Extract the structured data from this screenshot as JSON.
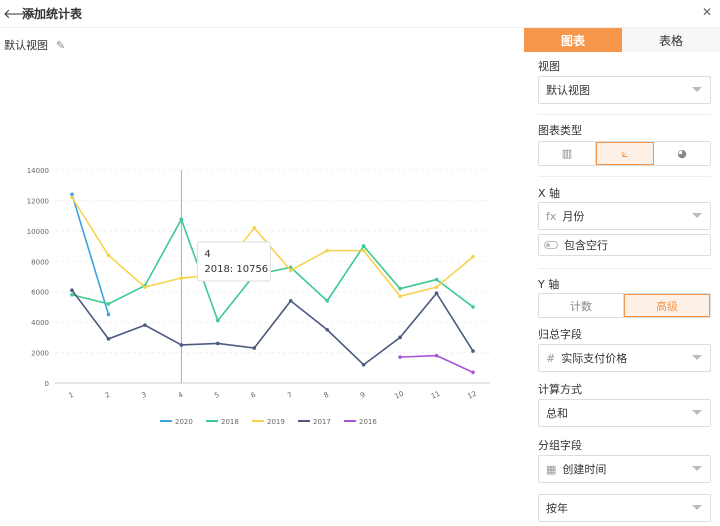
{
  "header": {
    "title": "添加统计表",
    "back_icon": "arrow-left-icon",
    "close_icon": "close-icon"
  },
  "view": {
    "name": "默认视图",
    "edit_icon": "pencil-icon"
  },
  "sidebar": {
    "tabs": [
      {
        "label": "图表",
        "active": true
      },
      {
        "label": "表格",
        "active": false
      }
    ],
    "view_label": "视图",
    "view_value": "默认视图",
    "chart_type_label": "图表类型",
    "chart_types": [
      {
        "icon": "bar-chart-icon",
        "glyph": "▥",
        "active": false
      },
      {
        "icon": "line-chart-icon",
        "glyph": "⟀",
        "active": true
      },
      {
        "icon": "pie-chart-icon",
        "glyph": "◕",
        "active": false
      }
    ],
    "x_axis_label": "X 轴",
    "x_axis_field": "月份",
    "x_axis_field_icon": "fx",
    "include_empty_label": "包含空行",
    "y_axis_label": "Y 轴",
    "y_axis_modes": [
      {
        "label": "计数",
        "active": false
      },
      {
        "label": "高级",
        "active": true
      }
    ],
    "agg_field_label": "归总字段",
    "agg_field_value": "实际支付价格",
    "agg_field_icon": "#",
    "calc_label": "计算方式",
    "calc_value": "总和",
    "group_label": "分组字段",
    "group_value": "创建时间",
    "group_icon": "▦",
    "group_granularity": "按年"
  },
  "colors": {
    "accent": "#f6964a"
  },
  "chart_data": {
    "type": "line",
    "categories": [
      "1",
      "2",
      "3",
      "4",
      "5",
      "6",
      "7",
      "8",
      "9",
      "10",
      "11",
      "12"
    ],
    "ylim": [
      0,
      14000
    ],
    "yticks": [
      0,
      2000,
      4000,
      6000,
      8000,
      10000,
      12000,
      14000
    ],
    "grid": true,
    "legend_position": "bottom",
    "series": [
      {
        "name": "2020",
        "color": "#3ba3e0",
        "values": [
          12400,
          4500,
          null,
          null,
          null,
          null,
          null,
          null,
          null,
          null,
          null,
          null
        ]
      },
      {
        "name": "2018",
        "color": "#3dca90",
        "values": [
          5800,
          5200,
          6400,
          10756,
          4100,
          7100,
          7600,
          5400,
          9000,
          6200,
          6800,
          5000
        ]
      },
      {
        "name": "2019",
        "color": "#f5d34f",
        "values": [
          12200,
          8400,
          6300,
          6900,
          7100,
          10200,
          7400,
          8700,
          8700,
          5700,
          6300,
          8300
        ]
      },
      {
        "name": "2017",
        "color": "#4c5a80",
        "values": [
          6100,
          2900,
          3800,
          2500,
          2600,
          2300,
          5400,
          3500,
          1200,
          3000,
          5900,
          2100
        ]
      },
      {
        "name": "2016",
        "color": "#a855d8",
        "values": [
          null,
          null,
          null,
          null,
          null,
          null,
          null,
          null,
          null,
          1700,
          1800,
          700
        ]
      }
    ],
    "tooltip": {
      "category": "4",
      "text": "2018: 10756"
    }
  }
}
